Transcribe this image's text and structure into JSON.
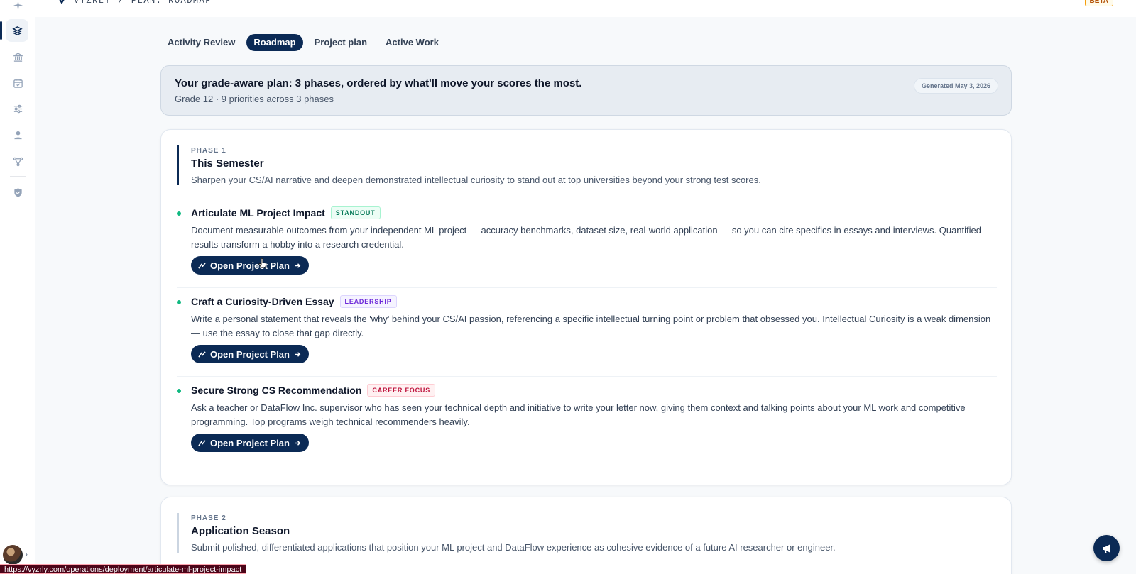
{
  "breadcrumb": {
    "brand": "VYZRLY",
    "separator": "/",
    "page": "PLAN: ROADMAP"
  },
  "beta_badge": "BETA",
  "tabs": [
    {
      "label": "Activity Review",
      "active": false
    },
    {
      "label": "Roadmap",
      "active": true
    },
    {
      "label": "Project plan",
      "active": false
    },
    {
      "label": "Active Work",
      "active": false
    }
  ],
  "summary": {
    "title": "Your grade-aware plan: 3 phases, ordered by what'll move your scores the most.",
    "subtitle": "Grade 12 · 9 priorities across 3 phases",
    "generated": "Generated May 3, 2026"
  },
  "phases": [
    {
      "label": "PHASE 1",
      "title": "This Semester",
      "description": "Sharpen your CS/AI narrative and deepen demonstrated intellectual curiosity to stand out at top universities beyond your strong test scores.",
      "items": [
        {
          "title": "Articulate ML Project Impact",
          "tag": "STANDOUT",
          "description": "Document measurable outcomes from your independent ML project — accuracy benchmarks, dataset size, real-world application — so you can cite specifics in essays and interviews. Quantified results transform a hobby into a research credential.",
          "button": "Open Project Plan"
        },
        {
          "title": "Craft a Curiosity-Driven Essay",
          "tag": "LEADERSHIP",
          "description": "Write a personal statement that reveals the 'why' behind your CS/AI passion, referencing a specific intellectual turning point or problem that obsessed you. Intellectual Curiosity is a weak dimension — use the essay to close that gap directly.",
          "button": "Open Project Plan"
        },
        {
          "title": "Secure Strong CS Recommendation",
          "tag": "CAREER FOCUS",
          "description": "Ask a teacher or DataFlow Inc. supervisor who has seen your technical depth and initiative to write your letter now, giving them context and talking points about your ML work and competitive programming. Top programs weigh technical recommenders heavily.",
          "button": "Open Project Plan"
        }
      ]
    },
    {
      "label": "PHASE 2",
      "title": "Application Season",
      "description": "Submit polished, differentiated applications that position your ML project and DataFlow experience as cohesive evidence of a future AI researcher or engineer."
    }
  ],
  "status_url": "https://vyzrly.com/operations/deployment/articulate-ml-project-impact",
  "colors": {
    "primary": "#0b2a55",
    "accent_green": "#10b981",
    "beta": "#b45309"
  }
}
